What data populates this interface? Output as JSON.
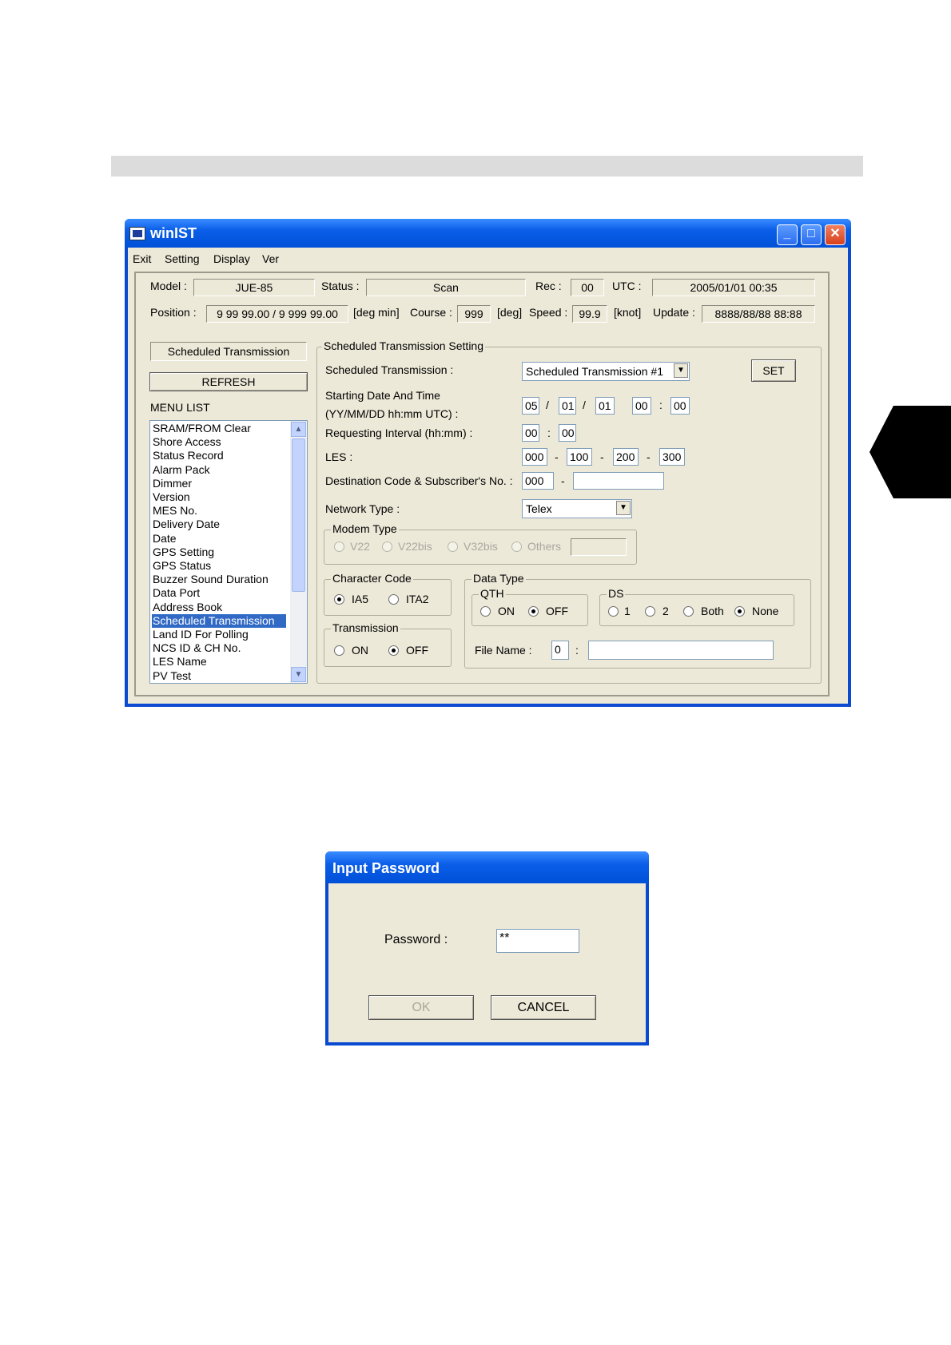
{
  "window": {
    "title": "winIST",
    "menu": [
      "Exit",
      "Setting",
      "Display",
      "Ver"
    ]
  },
  "status_bar": {
    "model_label": "Model :",
    "model": "JUE-85",
    "status_label": "Status :",
    "status": "Scan",
    "rec_label": "Rec :",
    "rec": "00",
    "utc_label": "UTC :",
    "utc": "2005/01/01 00:35",
    "position_label": "Position :",
    "position": "9 99 99.00 / 9 999 99.00",
    "position_unit": "[deg min]",
    "course_label": "Course :",
    "course": "999",
    "course_unit": "[deg]",
    "speed_label": "Speed :",
    "speed": "99.9",
    "speed_unit": "[knot]",
    "update_label": "Update :",
    "update": "8888/88/88 88:88"
  },
  "left_panel": {
    "current_mode": "Scheduled Transmission",
    "refresh_label": "REFRESH",
    "menu_list_label": "MENU LIST",
    "menu_items": [
      "SRAM/FROM Clear",
      "Shore Access",
      "Status Record",
      "Alarm Pack",
      "Dimmer",
      "Version",
      "MES No.",
      "Delivery Date",
      "Date",
      "GPS Setting",
      "GPS Status",
      "Buzzer Sound Duration",
      "Data Port",
      "Address Book",
      "Scheduled Transmission",
      "Land ID For Polling",
      "NCS ID & CH No.",
      "LES Name",
      "PV Test"
    ],
    "selected_item": "Scheduled Transmission"
  },
  "settings": {
    "group_title": "Scheduled Transmission Setting",
    "sched_label": "Scheduled Transmission :",
    "sched_value": "Scheduled Transmission #1",
    "set_label": "SET",
    "start_label_1": "Starting Date And Time",
    "start_label_2": "(YY/MM/DD hh:mm UTC) :",
    "start_yy": "05",
    "start_mm": "01",
    "start_dd": "01",
    "start_hh": "00",
    "start_min": "00",
    "slash": "/",
    "colon": ":",
    "dash": "-",
    "interval_label": "Requesting Interval (hh:mm) :",
    "interval_hh": "00",
    "interval_mm": "00",
    "les_label": "LES :",
    "les": [
      "000",
      "100",
      "200",
      "300"
    ],
    "dest_label": "Destination Code & Subscriber's No. :",
    "dest_code": "000",
    "subscriber_no": "",
    "network_label": "Network Type :",
    "network_value": "Telex",
    "modem_title": "Modem Type",
    "modem_options": [
      "V22",
      "V22bis",
      "V32bis",
      "Others"
    ],
    "modem_others_value": "",
    "char_code_title": "Character Code",
    "char_code_options": [
      "IA5",
      "ITA2"
    ],
    "char_code_selected": "IA5",
    "transmission_title": "Transmission",
    "transmission_options": [
      "ON",
      "OFF"
    ],
    "transmission_selected": "OFF",
    "data_type_title": "Data Type",
    "qth_title": "QTH",
    "qth_options": [
      "ON",
      "OFF"
    ],
    "qth_selected": "OFF",
    "ds_title": "DS",
    "ds_options": [
      "1",
      "2",
      "Both",
      "None"
    ],
    "ds_selected": "None",
    "file_name_label": "File Name :",
    "file_name_num": "0",
    "file_name_value": ""
  },
  "dialog": {
    "title": "Input Password",
    "password_label": "Password :",
    "password_value": "**",
    "ok_label": "OK",
    "cancel_label": "CANCEL"
  }
}
